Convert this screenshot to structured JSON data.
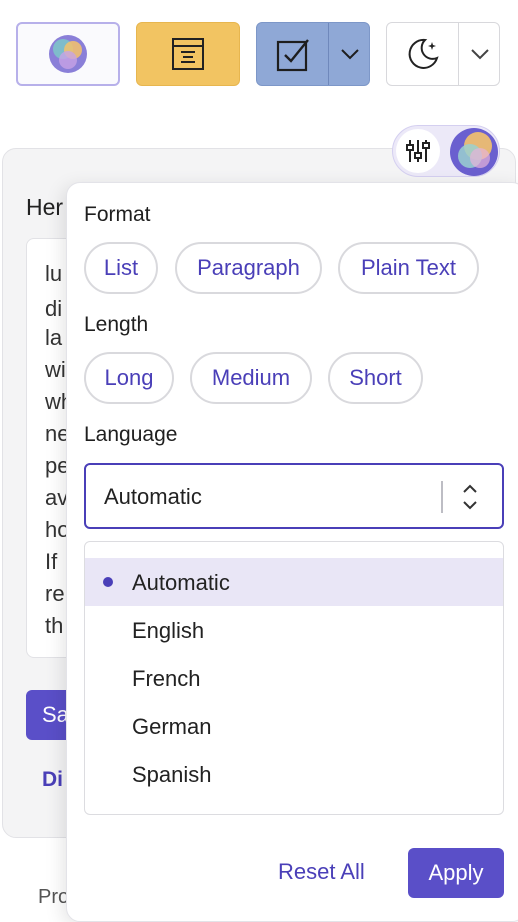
{
  "toolbar": {
    "ai_icon": "ai-orb-icon",
    "summary_icon": "summary-doc-icon",
    "check_icon": "checkbox-icon",
    "theme_icon": "moon-icon",
    "colors": {
      "summary": "#f2c462",
      "check": "#8fa8d6",
      "accent": "#4a3fb8"
    }
  },
  "background": {
    "heading": "Her",
    "text_lines": [
      "lu",
      "di",
      "la",
      "wi",
      "wh",
      "ne",
      "pe",
      "av",
      "ho",
      "If",
      "re",
      "th"
    ],
    "save_label": "Sa",
    "link_label": "Di",
    "footer_label": "Pro"
  },
  "popover": {
    "format": {
      "label": "Format",
      "options": [
        "List",
        "Paragraph",
        "Plain Text"
      ]
    },
    "length": {
      "label": "Length",
      "options": [
        "Long",
        "Medium",
        "Short"
      ]
    },
    "language": {
      "label": "Language",
      "selected": "Automatic",
      "options": [
        "Automatic",
        "English",
        "French",
        "German",
        "Spanish"
      ]
    },
    "reset_label": "Reset All",
    "apply_label": "Apply"
  }
}
